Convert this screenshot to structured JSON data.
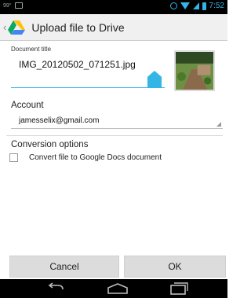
{
  "status_bar": {
    "left_text": "99°",
    "time": "7:52",
    "icons": [
      "image-notification-icon",
      "alarm-icon",
      "wifi-icon",
      "signal-icon",
      "battery-icon"
    ]
  },
  "action_bar": {
    "title": "Upload file to Drive",
    "icons": [
      "back-chevron-icon",
      "drive-logo-icon"
    ]
  },
  "document_title": {
    "label": "Document title",
    "value": "IMG_20120502_071251.jpg"
  },
  "account": {
    "label": "Account",
    "value": "jamesselix@gmail.com"
  },
  "conversion": {
    "label": "Conversion options",
    "checkbox_label": "Convert file to Google Docs document",
    "checked": false
  },
  "buttons": {
    "cancel": "Cancel",
    "ok": "OK"
  },
  "colors": {
    "accent": "#33b5e5",
    "drive_green": "#0da960",
    "drive_yellow": "#ffc107",
    "drive_blue": "#4285f4"
  }
}
